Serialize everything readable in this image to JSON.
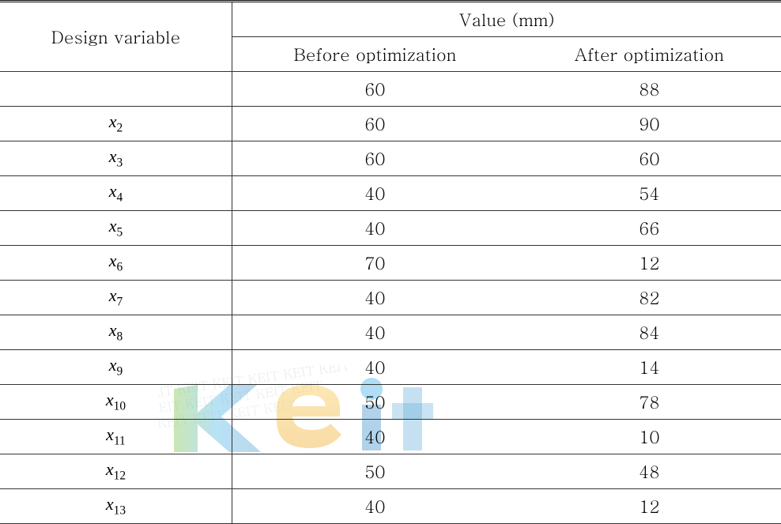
{
  "table": {
    "header": {
      "design_variable": "Design variable",
      "value": "Value (mm)",
      "before": "Before optimization",
      "after": "After optimization"
    },
    "rows": [
      {
        "var_base": "",
        "var_sub": "",
        "before": "60",
        "after": "88"
      },
      {
        "var_base": "x",
        "var_sub": "2",
        "before": "60",
        "after": "90"
      },
      {
        "var_base": "x",
        "var_sub": "3",
        "before": "60",
        "after": "60"
      },
      {
        "var_base": "x",
        "var_sub": "4",
        "before": "40",
        "after": "54"
      },
      {
        "var_base": "x",
        "var_sub": "5",
        "before": "40",
        "after": "66"
      },
      {
        "var_base": "x",
        "var_sub": "6",
        "before": "70",
        "after": "12"
      },
      {
        "var_base": "x",
        "var_sub": "7",
        "before": "40",
        "after": "82"
      },
      {
        "var_base": "x",
        "var_sub": "8",
        "before": "40",
        "after": "84"
      },
      {
        "var_base": "x",
        "var_sub": "9",
        "before": "40",
        "after": "14"
      },
      {
        "var_base": "x",
        "var_sub": "10",
        "before": "50",
        "after": "78"
      },
      {
        "var_base": "x",
        "var_sub": "11",
        "before": "40",
        "after": "10"
      },
      {
        "var_base": "x",
        "var_sub": "12",
        "before": "50",
        "after": "48"
      },
      {
        "var_base": "x",
        "var_sub": "13",
        "before": "40",
        "after": "12"
      }
    ]
  }
}
